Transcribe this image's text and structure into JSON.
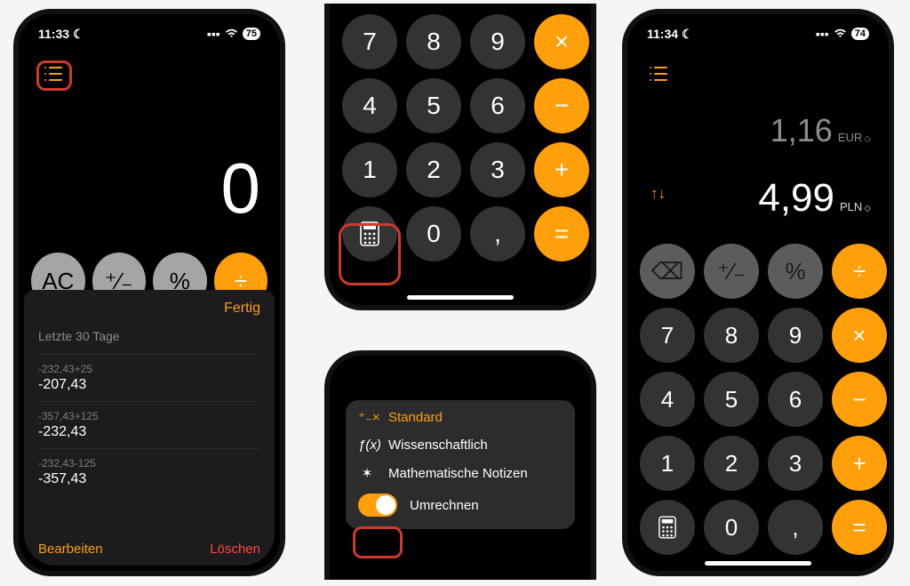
{
  "colors": {
    "accent": "#ff9f0a",
    "danger": "#ff453a",
    "btn_gray": "#a5a5a5",
    "btn_dark": "#333333",
    "btn_orange": "#ff9f0a"
  },
  "phone1": {
    "status_time": "11:33",
    "battery": "75",
    "display_value": "0",
    "top_row": {
      "ac": "AC",
      "sign": "⁺⁄₋",
      "percent": "%",
      "divide": "÷"
    },
    "sheet": {
      "done": "Fertig",
      "section_title": "Letzte 30 Tage",
      "history": [
        {
          "expr": "-232,43+25",
          "result": "-207,43"
        },
        {
          "expr": "-357,43+125",
          "result": "-232,43"
        },
        {
          "expr": "-232,43-125",
          "result": "-357,43"
        }
      ],
      "edit": "Bearbeiten",
      "delete": "Löschen"
    }
  },
  "phone2": {
    "keys": [
      "7",
      "8",
      "9",
      "×",
      "4",
      "5",
      "6",
      "−",
      "1",
      "2",
      "3",
      "+",
      "calc-icon",
      "0",
      ",",
      "="
    ]
  },
  "phone3": {
    "modes": {
      "standard": {
        "label": "Standard",
        "icon": "⁺₋×"
      },
      "scientific": {
        "label": "Wissenschaftlich",
        "icon": "ƒ(x)"
      },
      "mathnotes": {
        "label": "Mathematische Notizen",
        "icon": "✶"
      },
      "convert": {
        "label": "Umrechnen"
      }
    }
  },
  "phone4": {
    "status_time": "11:34",
    "battery": "74",
    "value_top": "1,16",
    "currency_top": "EUR",
    "value_bottom": "4,99",
    "currency_bottom": "PLN",
    "row1": {
      "del": "⌫",
      "sign": "⁺⁄₋",
      "percent": "%",
      "divide": "÷"
    },
    "keys": [
      "7",
      "8",
      "9",
      "×",
      "4",
      "5",
      "6",
      "−",
      "1",
      "2",
      "3",
      "+",
      "calc-icon",
      "0",
      ",",
      "="
    ]
  }
}
